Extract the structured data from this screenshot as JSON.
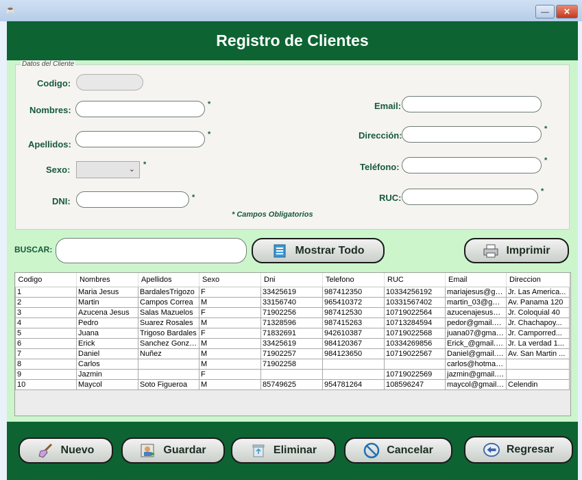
{
  "window": {
    "title": ""
  },
  "header": {
    "title": "Registro de Clientes"
  },
  "form": {
    "legend": "Datos del Cliente",
    "codigo_label": "Codigo:",
    "nombres_label": "Nombres:",
    "apellidos_label": "Apellidos:",
    "sexo_label": "Sexo:",
    "dni_label": "DNI:",
    "email_label": "Email:",
    "direccion_label": "Dirección:",
    "telefono_label": "Teléfono:",
    "ruc_label": "RUC:",
    "required_mark": "*",
    "required_note": "* Campos Obligatorios",
    "codigo_value": "",
    "nombres_value": "",
    "apellidos_value": "",
    "sexo_value": "",
    "dni_value": "",
    "email_value": "",
    "direccion_value": "",
    "telefono_value": "",
    "ruc_value": ""
  },
  "search": {
    "label": "BUSCAR:",
    "value": "",
    "show_all_label": "Mostrar Todo",
    "print_label": "Imprimir"
  },
  "table": {
    "columns": [
      "Codigo",
      "Nombres",
      "Apellidos",
      "Sexo",
      "Dni",
      "Telefono",
      "RUC",
      "Email",
      "Direccion"
    ],
    "rows": [
      [
        "1",
        "Maria Jesus",
        "BardalesTrigozo",
        "F",
        "33425619",
        "987412350",
        "10334256192",
        "mariajesus@gm...",
        "Jr. Las America..."
      ],
      [
        "2",
        "Martin",
        "Campos Correa",
        "M",
        "33156740",
        "965410372",
        "10331567402",
        "martin_03@gm...",
        "Av. Panama 120"
      ],
      [
        "3",
        "Azucena Jesus",
        "Salas Mazuelos",
        "F",
        "71902256",
        "987412530",
        "10719022564",
        "azucenajesus@...",
        "Jr. Coloquial 40"
      ],
      [
        "4",
        "Pedro",
        "Suarez Rosales",
        "M",
        "71328596",
        "987415263",
        "10713284594",
        "pedor@gmail.com",
        "Jr. Chachapoy..."
      ],
      [
        "5",
        "Juana",
        "Trigoso Bardales",
        "F",
        "71832691",
        "942610387",
        "10719022568",
        "juana07@gmail....",
        "Jr. Camporred..."
      ],
      [
        "6",
        "Erick",
        "Sanchez Gonzales",
        "M",
        "33425619",
        "984120367",
        "10334269856",
        "Erick_@gmail.com",
        "Jr. La verdad 1..."
      ],
      [
        "7",
        "Daniel",
        "Nuñez",
        "M",
        "71902257",
        "984123650",
        "10719022567",
        "Daniel@gmail.com",
        "Av. San Martin ..."
      ],
      [
        "8",
        "Carlos",
        "",
        "M",
        "71902258",
        "",
        "",
        "carlos@hotmail....",
        ""
      ],
      [
        "9",
        "Jazmin",
        "",
        "F",
        "",
        "",
        "10719022569",
        "jazmin@gmail.com",
        ""
      ],
      [
        "10",
        "Maycol",
        "Soto Figueroa",
        "M",
        "85749625",
        "954781264",
        "108596247",
        "maycol@gmail....",
        "Celendin"
      ]
    ]
  },
  "footer": {
    "nuevo_label": "Nuevo",
    "guardar_label": "Guardar",
    "eliminar_label": "Eliminar",
    "cancelar_label": "Cancelar",
    "regresar_label": "Regresar"
  },
  "icons": {
    "java": "java-icon",
    "minimize": "minimize-icon",
    "close": "close-icon",
    "show_all": "list-icon",
    "print": "printer-icon",
    "nuevo": "broom-icon",
    "guardar": "save-user-icon",
    "eliminar": "trash-icon",
    "cancelar": "cancel-icon",
    "regresar": "back-arrow-icon"
  },
  "colors": {
    "header_green": "#0d6432",
    "panel_green": "#ccf5cc",
    "label_green": "#16593a"
  }
}
